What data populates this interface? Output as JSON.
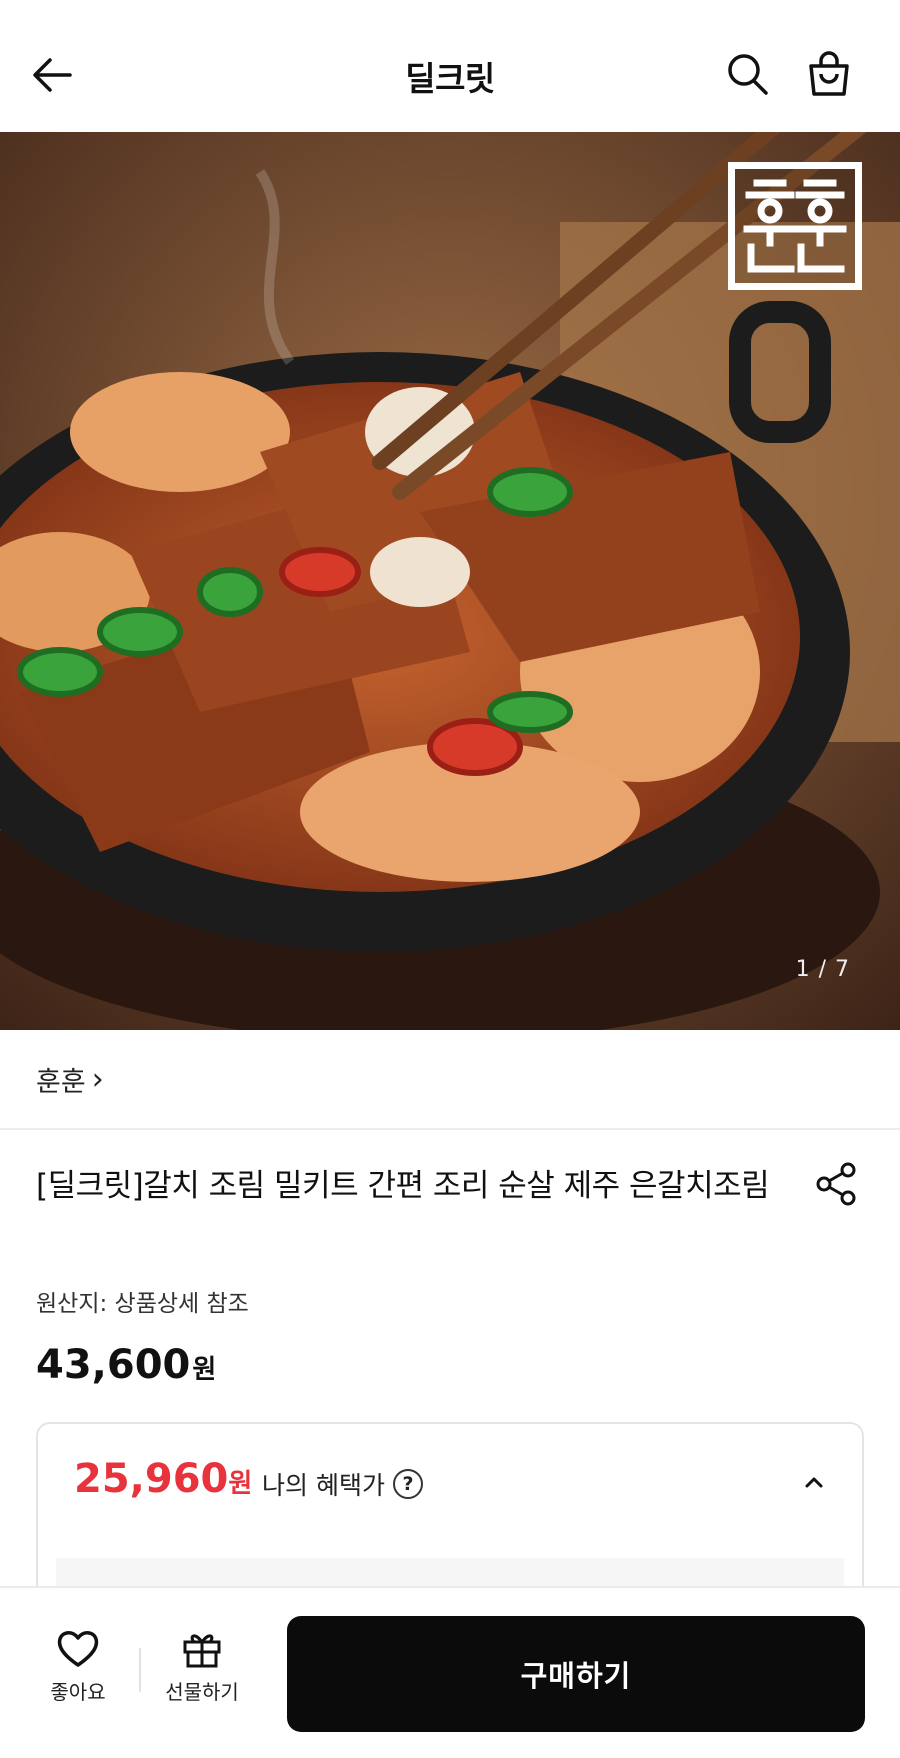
{
  "header": {
    "title": "딜크릿",
    "back_icon": "arrow-left-icon",
    "search_icon": "search-icon",
    "cart_icon": "shopping-bag-icon"
  },
  "hero": {
    "image_counter": "1 / 7",
    "brand_logo_text": "훈훈"
  },
  "brand": {
    "name": "훈훈",
    "chevron": "›"
  },
  "product": {
    "title": "[딜크릿]갈치 조림 밀키트 간편 조리 순살 제주 은갈치조림",
    "origin": "원산지: 상품상세 참조",
    "price": "43,600",
    "price_unit": "원"
  },
  "benefit": {
    "sale_price": "25,960",
    "sale_unit": "원",
    "label": "나의 혜택가",
    "help_symbol": "?",
    "sale_color": "#e8333c"
  },
  "bottom_bar": {
    "like_label": "좋아요",
    "gift_label": "선물하기",
    "buy_label": "구매하기"
  }
}
